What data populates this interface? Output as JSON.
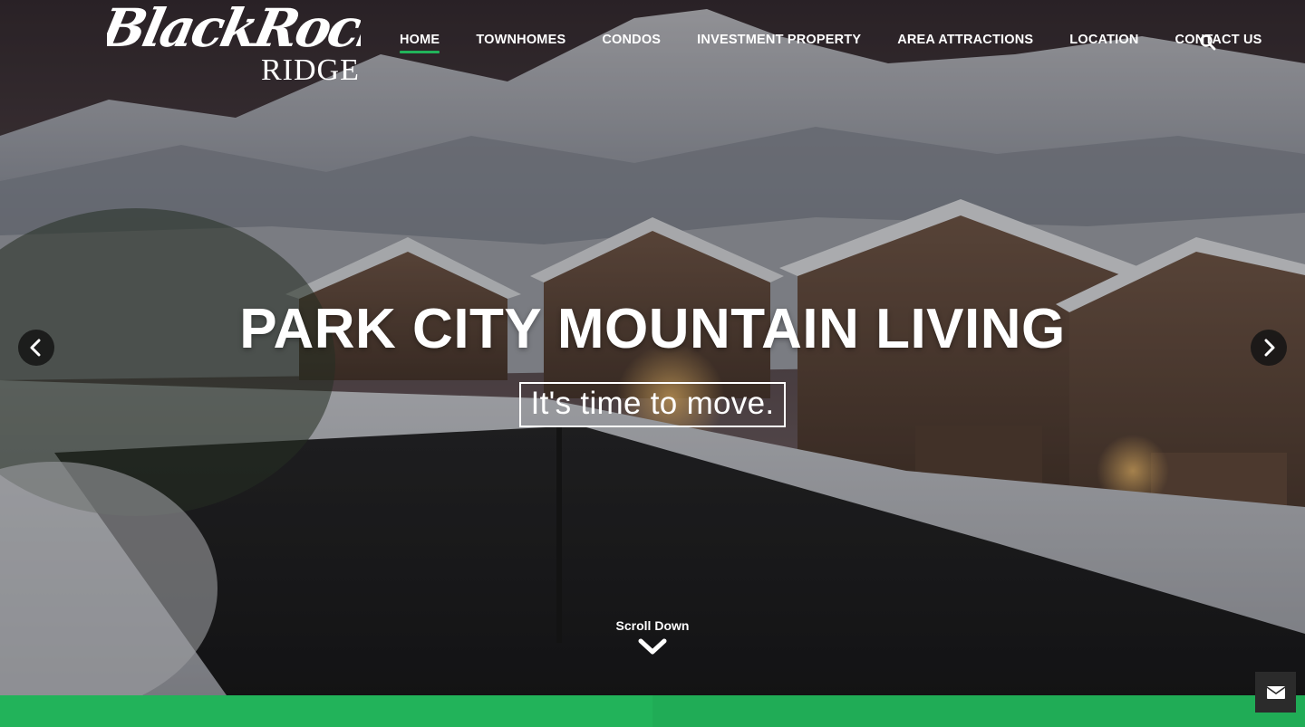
{
  "brand": {
    "logo_script": "BlackRock",
    "logo_word": "RIDGE"
  },
  "nav": {
    "items": [
      {
        "label": "HOME",
        "active": true
      },
      {
        "label": "TOWNHOMES",
        "active": false
      },
      {
        "label": "CONDOS",
        "active": false
      },
      {
        "label": "INVESTMENT PROPERTY",
        "active": false
      },
      {
        "label": "AREA ATTRACTIONS",
        "active": false
      },
      {
        "label": "LOCATION",
        "active": false
      },
      {
        "label": "CONTACT US",
        "active": false
      }
    ],
    "search_icon": "search-icon"
  },
  "hero": {
    "headline": "PARK CITY MOUNTAIN LIVING",
    "tagline": "It's time to move.",
    "prev_icon": "chevron-left-icon",
    "next_icon": "chevron-right-icon"
  },
  "scroll": {
    "label": "Scroll Down",
    "icon": "chevron-down-icon"
  },
  "contact_widget": {
    "icon": "envelope-icon"
  },
  "colors": {
    "accent": "#22b35a",
    "text": "#ffffff",
    "dark_button": "#2b2b2b"
  }
}
